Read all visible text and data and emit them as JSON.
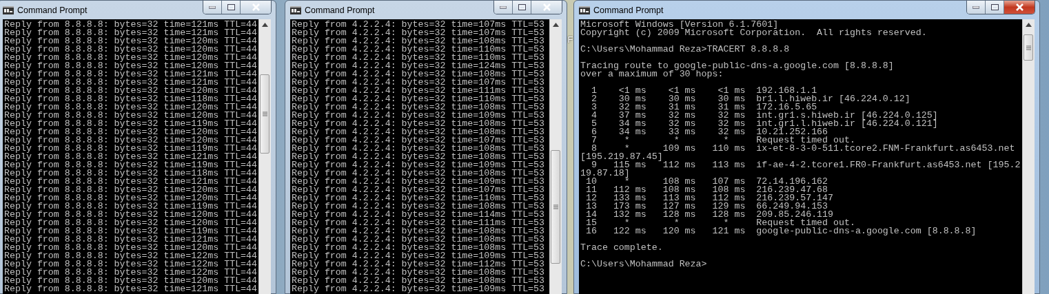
{
  "desktop": {
    "icon_label": "F"
  },
  "windows": [
    {
      "title": "Command Prompt",
      "active": false,
      "blocks": [
        [
          "Reply from 8.8.8.8: bytes=32 time=121ms TTL=44",
          "Reply from 8.8.8.8: bytes=32 time=121ms TTL=44",
          "Reply from 8.8.8.8: bytes=32 time=120ms TTL=44",
          "Reply from 8.8.8.8: bytes=32 time=120ms TTL=44",
          "Reply from 8.8.8.8: bytes=32 time=120ms TTL=44",
          "Reply from 8.8.8.8: bytes=32 time=120ms TTL=44",
          "Reply from 8.8.8.8: bytes=32 time=121ms TTL=44",
          "Reply from 8.8.8.8: bytes=32 time=121ms TTL=44",
          "Reply from 8.8.8.8: bytes=32 time=120ms TTL=44",
          "Reply from 8.8.8.8: bytes=32 time=118ms TTL=44",
          "Reply from 8.8.8.8: bytes=32 time=120ms TTL=44",
          "Reply from 8.8.8.8: bytes=32 time=120ms TTL=44",
          "Reply from 8.8.8.8: bytes=32 time=119ms TTL=44",
          "Reply from 8.8.8.8: bytes=32 time=120ms TTL=44",
          "Reply from 8.8.8.8: bytes=32 time=120ms TTL=44",
          "Reply from 8.8.8.8: bytes=32 time=119ms TTL=44",
          "Reply from 8.8.8.8: bytes=32 time=121ms TTL=44",
          "Reply from 8.8.8.8: bytes=32 time=119ms TTL=44",
          "Reply from 8.8.8.8: bytes=32 time=118ms TTL=44",
          "Reply from 8.8.8.8: bytes=32 time=121ms TTL=44",
          "Reply from 8.8.8.8: bytes=32 time=120ms TTL=44",
          "Reply from 8.8.8.8: bytes=32 time=120ms TTL=44",
          "Reply from 8.8.8.8: bytes=32 time=119ms TTL=44",
          "Reply from 8.8.8.8: bytes=32 time=120ms TTL=44",
          "Reply from 8.8.8.8: bytes=32 time=120ms TTL=44",
          "Reply from 8.8.8.8: bytes=32 time=119ms TTL=44",
          "Reply from 8.8.8.8: bytes=32 time=121ms TTL=44",
          "Reply from 8.8.8.8: bytes=32 time=120ms TTL=44",
          "Reply from 8.8.8.8: bytes=32 time=122ms TTL=44",
          "Reply from 8.8.8.8: bytes=32 time=122ms TTL=44",
          "Reply from 8.8.8.8: bytes=32 time=122ms TTL=44",
          "Reply from 8.8.8.8: bytes=32 time=120ms TTL=44",
          "Reply from 8.8.8.8: bytes=32 time=121ms TTL=44"
        ]
      ]
    },
    {
      "title": "Command Prompt",
      "active": false,
      "blocks": [
        [
          "Reply from 4.2.2.4: bytes=32 time=107ms TTL=53",
          "Reply from 4.2.2.4: bytes=32 time=107ms TTL=53",
          "Reply from 4.2.2.4: bytes=32 time=108ms TTL=53",
          "Reply from 4.2.2.4: bytes=32 time=110ms TTL=53",
          "Reply from 4.2.2.4: bytes=32 time=110ms TTL=53",
          "Reply from 4.2.2.4: bytes=32 time=124ms TTL=53",
          "Reply from 4.2.2.4: bytes=32 time=108ms TTL=53",
          "Reply from 4.2.2.4: bytes=32 time=107ms TTL=53",
          "Reply from 4.2.2.4: bytes=32 time=111ms TTL=53",
          "Reply from 4.2.2.4: bytes=32 time=110ms TTL=53",
          "Reply from 4.2.2.4: bytes=32 time=108ms TTL=53",
          "Reply from 4.2.2.4: bytes=32 time=109ms TTL=53",
          "Reply from 4.2.2.4: bytes=32 time=108ms TTL=53",
          "Reply from 4.2.2.4: bytes=32 time=108ms TTL=53",
          "Reply from 4.2.2.4: bytes=32 time=107ms TTL=53",
          "Reply from 4.2.2.4: bytes=32 time=108ms TTL=53",
          "Reply from 4.2.2.4: bytes=32 time=108ms TTL=53",
          "Reply from 4.2.2.4: bytes=32 time=109ms TTL=53",
          "Reply from 4.2.2.4: bytes=32 time=108ms TTL=53",
          "Reply from 4.2.2.4: bytes=32 time=109ms TTL=53",
          "Reply from 4.2.2.4: bytes=32 time=107ms TTL=53",
          "Reply from 4.2.2.4: bytes=32 time=110ms TTL=53",
          "Reply from 4.2.2.4: bytes=32 time=108ms TTL=53",
          "Reply from 4.2.2.4: bytes=32 time=114ms TTL=53",
          "Reply from 4.2.2.4: bytes=32 time=111ms TTL=53",
          "Reply from 4.2.2.4: bytes=32 time=108ms TTL=53",
          "Reply from 4.2.2.4: bytes=32 time=108ms TTL=53",
          "Reply from 4.2.2.4: bytes=32 time=108ms TTL=53",
          "Reply from 4.2.2.4: bytes=32 time=109ms TTL=53",
          "Reply from 4.2.2.4: bytes=32 time=112ms TTL=53",
          "Reply from 4.2.2.4: bytes=32 time=108ms TTL=53",
          "Reply from 4.2.2.4: bytes=32 time=108ms TTL=53",
          "Reply from 4.2.2.4: bytes=32 time=109ms TTL=53"
        ]
      ]
    },
    {
      "title": "Command Prompt",
      "active": true,
      "blocks": [
        [
          "Microsoft Windows [Version 6.1.7601]",
          "Copyright (c) 2009 Microsoft Corporation.  All rights reserved."
        ],
        [
          "C:\\Users\\Mohammad Reza>TRACERT 8.8.8.8"
        ],
        [
          "Tracing route to google-public-dns-a.google.com [8.8.8.8]",
          "over a maximum of 30 hops:"
        ],
        [
          "  1    <1 ms    <1 ms    <1 ms  192.168.1.1",
          "  2    30 ms    30 ms    30 ms  br1.l.hiweb.ir [46.224.0.12]",
          "  3    32 ms    31 ms    31 ms  172.16.5.65",
          "  4    37 ms    32 ms    32 ms  int.gr1.s.hiweb.ir [46.224.0.125]",
          "  5    34 ms    32 ms    32 ms  int.gr1.l.hiweb.ir [46.224.0.121]",
          "  6    34 ms    33 ms    32 ms  10.21.252.166",
          "  7     *        *        *     Request timed out.",
          "  8     *      109 ms   110 ms  ix-et-8-3-0-511.tcore2.FNM-Frankfurt.as6453.net",
          "[195.219.87.45]",
          "  9   115 ms   112 ms   113 ms  if-ae-4-2.tcore1.FR0-Frankfurt.as6453.net [195.2",
          "19.87.18]",
          " 10     *      108 ms   107 ms  72.14.196.162",
          " 11   112 ms   108 ms   108 ms  216.239.47.68",
          " 12   133 ms   113 ms   112 ms  216.239.57.147",
          " 13   173 ms   127 ms   129 ms  66.249.94.153",
          " 14   132 ms   128 ms   128 ms  209.85.246.119",
          " 15     *        *        *     Request timed out.",
          " 16   122 ms   120 ms   121 ms  google-public-dns-a.google.com [8.8.8.8]"
        ],
        [
          "Trace complete."
        ],
        [
          "C:\\Users\\Mohammad Reza>"
        ]
      ]
    }
  ]
}
